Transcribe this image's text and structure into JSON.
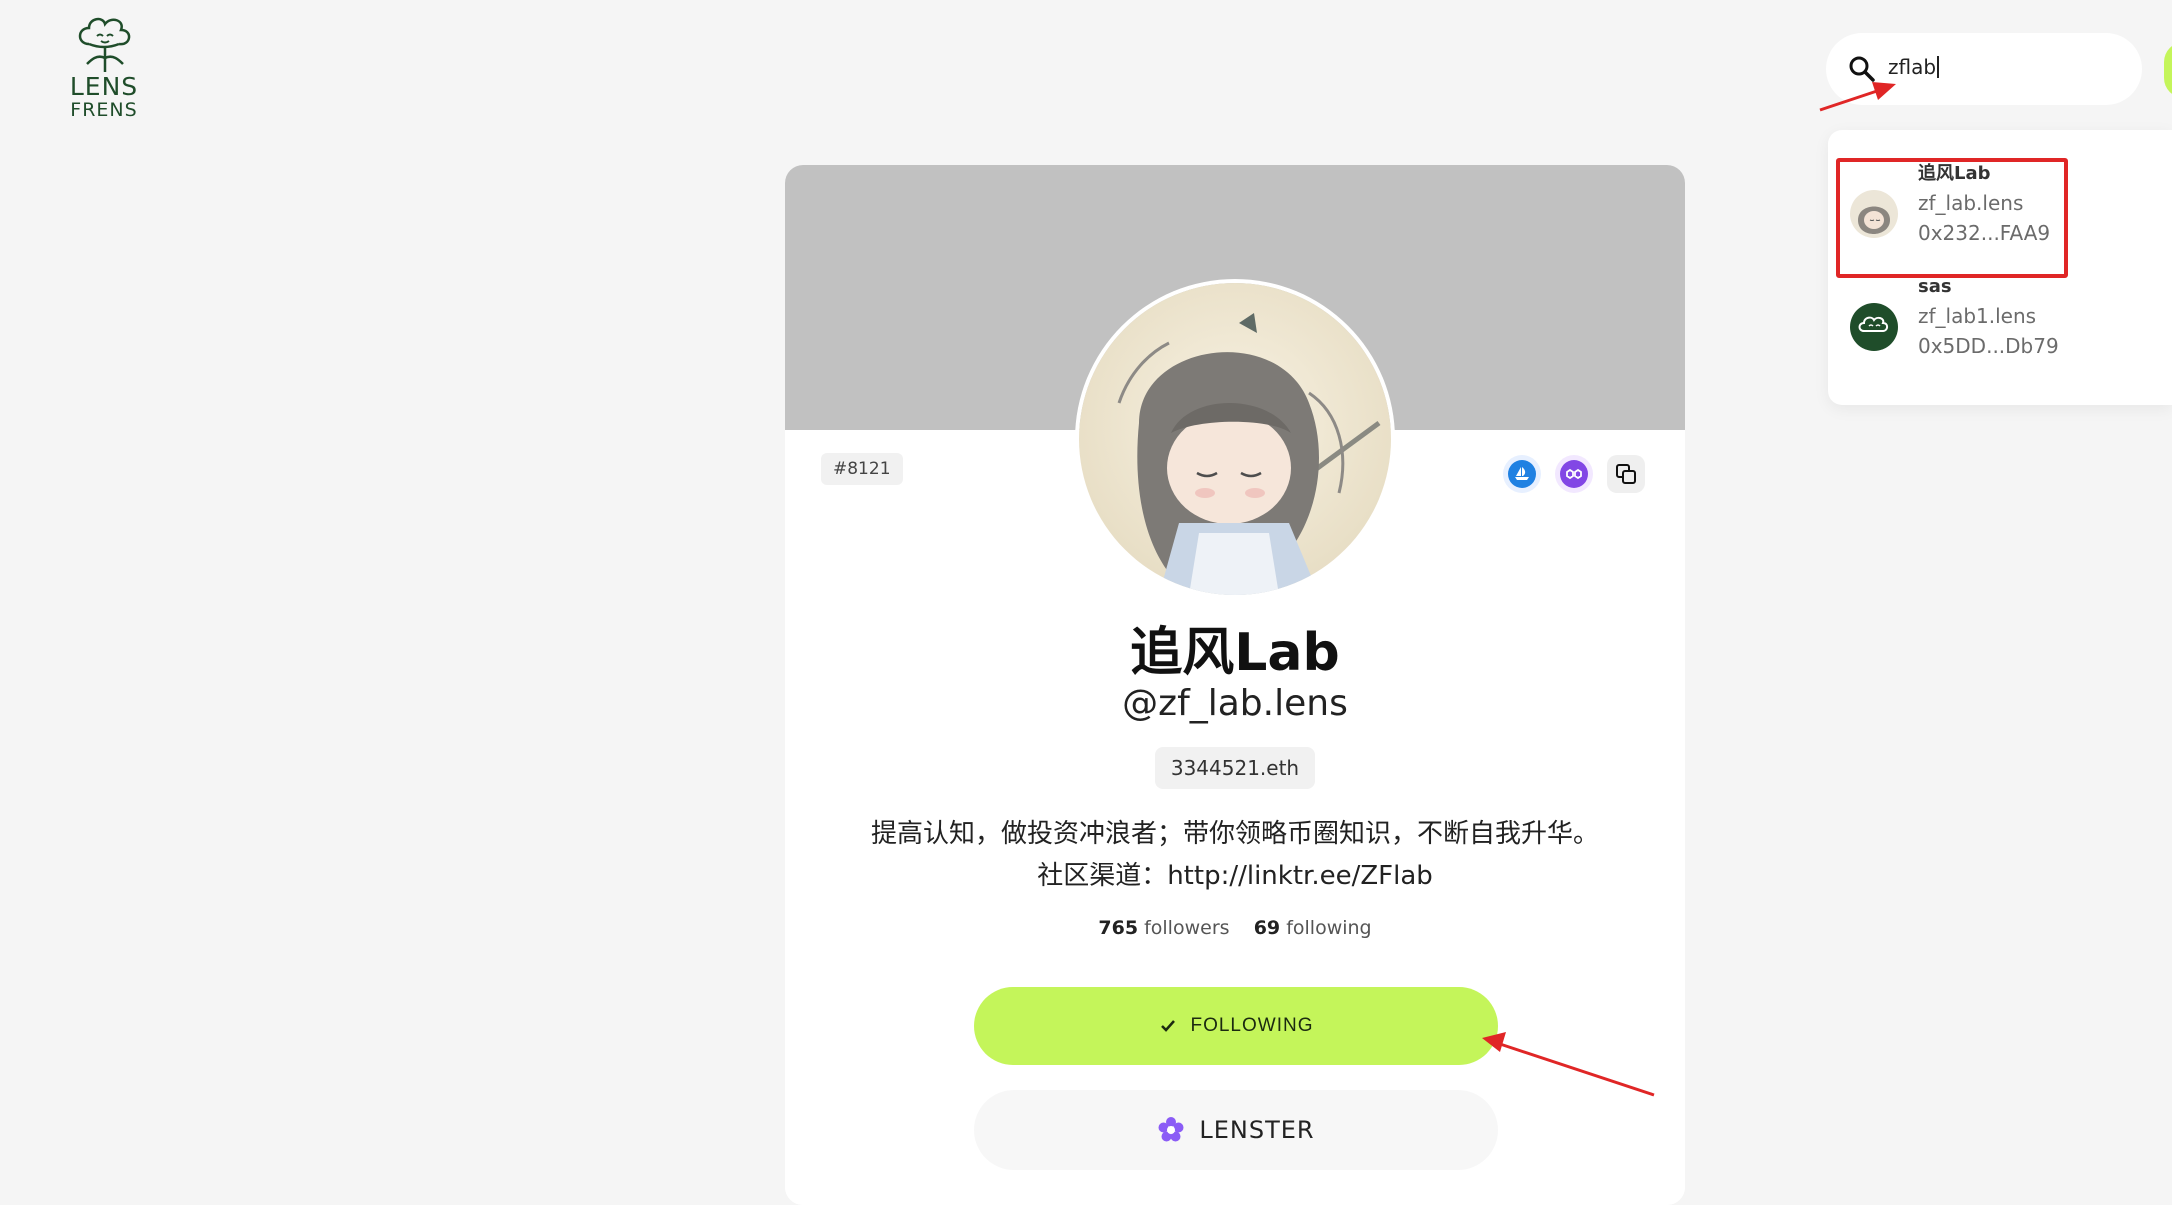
{
  "brand": {
    "logo_line1": "LENS",
    "logo_line2": "FRENS"
  },
  "search": {
    "value": "zflab"
  },
  "results": [
    {
      "name": "追风Lab",
      "handle": "zf_lab.lens",
      "address": "0x232...FAA9"
    },
    {
      "name": "sas",
      "handle": "zf_lab1.lens",
      "address": "0x5DD...Db79"
    }
  ],
  "profile": {
    "token_id": "#8121",
    "display_name": "追风Lab",
    "handle": "@zf_lab.lens",
    "ens": "3344521.eth",
    "bio_line1": "提高认知，做投资冲浪者；带你领略币圈知识，不断自我升华。",
    "bio_line2": "社区渠道：http://linktr.ee/ZFlab",
    "followers_count": "765",
    "followers_label": "followers",
    "following_count": "69",
    "following_label": "following"
  },
  "actions": {
    "follow_label": "FOLLOWING",
    "lenster_label": "LENSTER"
  },
  "colors": {
    "accent": "#c4f55a",
    "brand_green": "#1f4d2a",
    "annotation_red": "#e02626",
    "cover": "#c1c1c1"
  }
}
